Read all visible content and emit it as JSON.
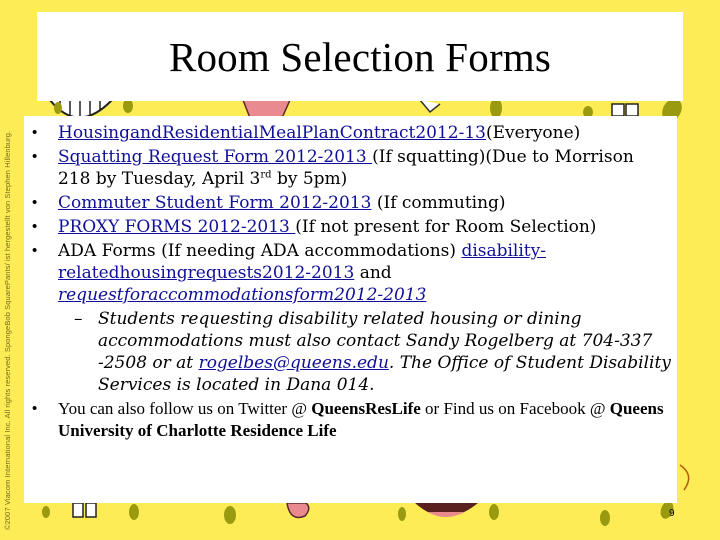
{
  "slide": {
    "title": "Room Selection Forms",
    "page_number": "9",
    "copyright": "©2007 Viacom International Inc. All rights reserved. SpongeBob SquarePants/ ist hergestellt von Stephen Hillenburg.",
    "colors": {
      "background": "#fdec55",
      "spots": "#9a9a10",
      "link": "#0f0f99",
      "box": "#ffffff"
    }
  },
  "items": [
    {
      "link": "HousingandResidentialMealPlanContract2012-13",
      "text": "(Everyone)"
    },
    {
      "link": "Squatting Request Form 2012-2013 ",
      "text": " (If squatting)(Due to Morrison 218 by Tuesday, April 3",
      "sup": "rd",
      "text_after": " by 5pm)"
    },
    {
      "link": "Commuter Student Form 2012-2013",
      "text": " (If commuting)"
    },
    {
      "link": "PROXY FORMS 2012-2013 ",
      "text": " (If not present for Room Selection)"
    },
    {
      "text": "ADA Forms (If needing ADA accommodations) ",
      "link": "disability-relatedhousingrequests2012-2013",
      "text_mid": " and ",
      "link2": "requestforaccommodationsform2012-2013",
      "sub": {
        "text": "Students requesting disability related housing or dining accommodations must also contact Sandy Rogelberg at 704-337 -2508 or at ",
        "link": "rogelbes@queens.edu",
        "text_after": ".  The Office of Student Disability Services is located in Dana 014."
      }
    },
    {
      "text": "You can also follow us on Twitter @ ",
      "bold1": "QueensResLife",
      "text_mid": " or Find us on Facebook @ ",
      "bold2": "Queens University of Charlotte Residence Life"
    }
  ],
  "bullet_char": "•",
  "dash_char": "–"
}
